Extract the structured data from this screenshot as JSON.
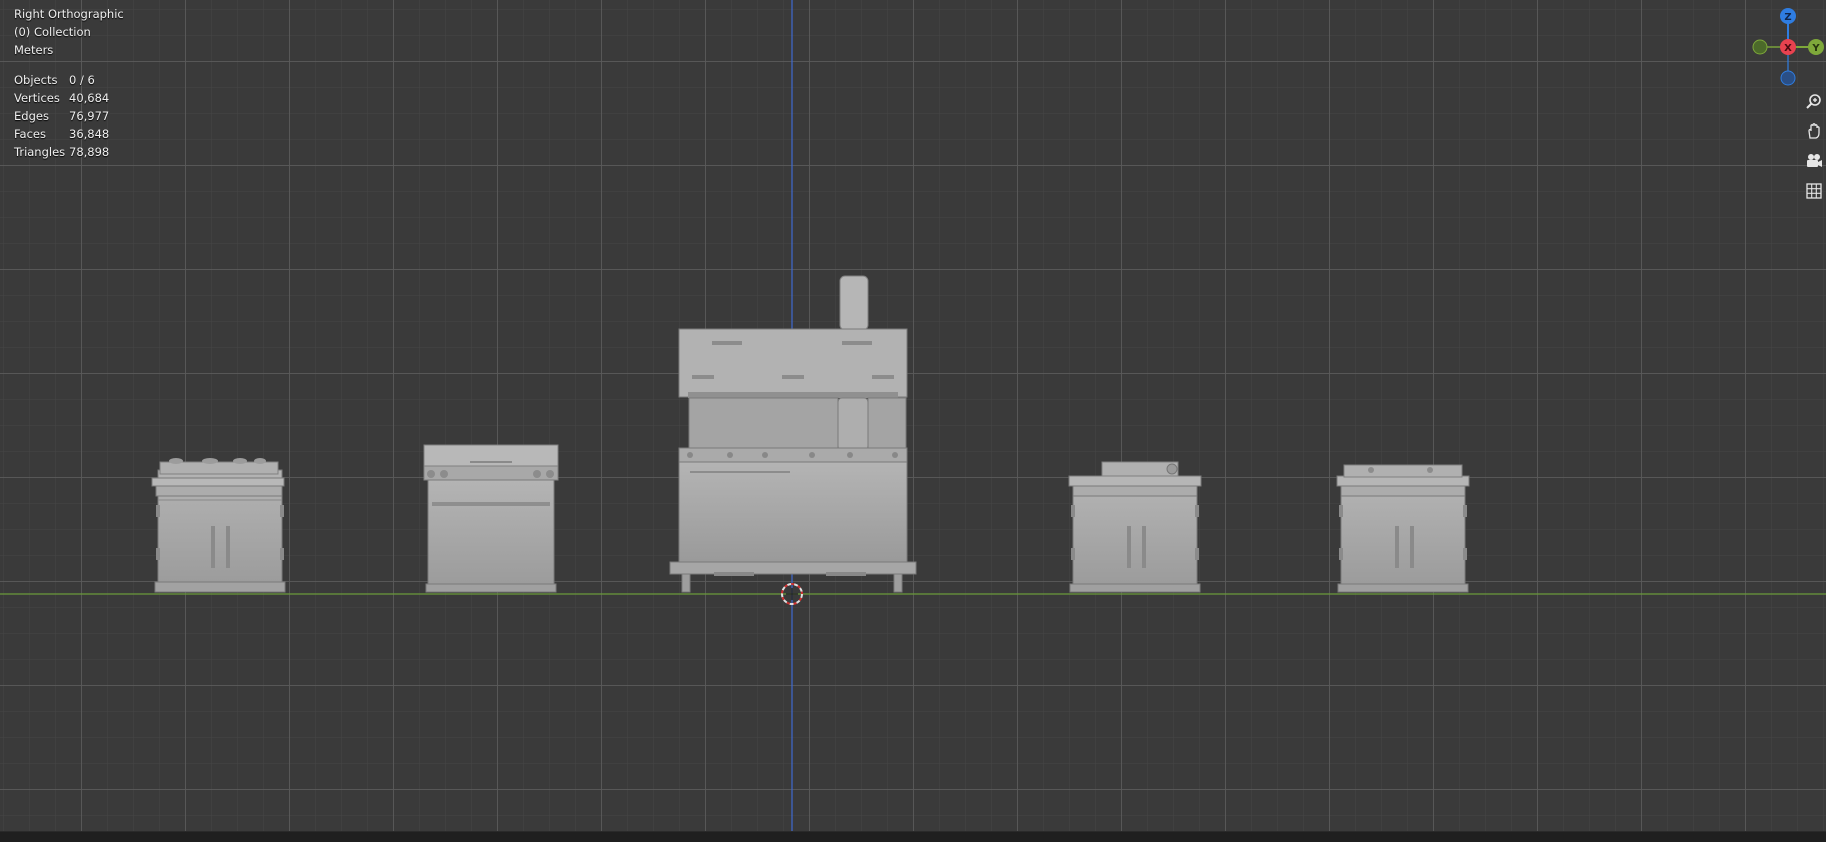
{
  "viewport": {
    "view_name": "Right Orthographic",
    "collection": "(0) Collection",
    "units": "Meters"
  },
  "stats": [
    {
      "label": "Objects",
      "value": "0 / 6"
    },
    {
      "label": "Vertices",
      "value": "40,684"
    },
    {
      "label": "Edges",
      "value": "76,977"
    },
    {
      "label": "Faces",
      "value": "36,848"
    },
    {
      "label": "Triangles",
      "value": "78,898"
    }
  ],
  "gizmo": {
    "z_label": "Z",
    "x_label": "X",
    "y_label": "Y",
    "z_color": "#2f7de1",
    "x_color": "#e8424f",
    "y_color": "#7ea83a"
  },
  "colors": {
    "background": "#3a3a3a",
    "grid_line": "#5a5a5a",
    "y_axis": "#6a9a3a",
    "z_axis": "#3f6ad0",
    "mesh": "#a6a6a6"
  },
  "tools": [
    "zoom-icon",
    "hand-pan-icon",
    "camera-icon",
    "grid-icon"
  ]
}
